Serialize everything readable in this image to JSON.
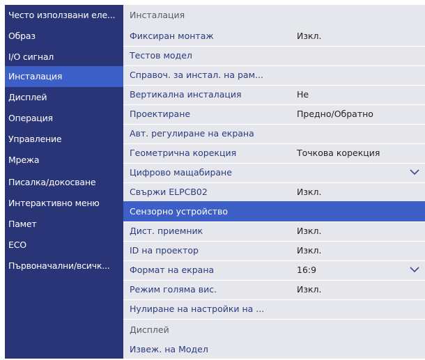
{
  "sidebar": {
    "items": [
      {
        "label": "Често използвани еле..."
      },
      {
        "label": "Образ"
      },
      {
        "label": "I/O сигнал"
      },
      {
        "label": "Инсталация"
      },
      {
        "label": "Дисплей"
      },
      {
        "label": "Операция"
      },
      {
        "label": "Управление"
      },
      {
        "label": "Мрежа"
      },
      {
        "label": "Писалка/докосване"
      },
      {
        "label": "Интерактивно меню"
      },
      {
        "label": "Памет"
      },
      {
        "label": "ECO"
      },
      {
        "label": "Първоначални/всичк..."
      }
    ],
    "selected": "Инсталация"
  },
  "main": {
    "section_install": "Инсталация",
    "rows": [
      {
        "label": "Фиксиран монтаж",
        "value": "Изкл."
      },
      {
        "label": "Тестов модел",
        "value": ""
      },
      {
        "label": "Справоч. за инстал. на рам...",
        "value": ""
      },
      {
        "label": "Вертикална инсталация",
        "value": "Не"
      },
      {
        "label": "Проектиране",
        "value": "Предно/Обратно"
      },
      {
        "label": "Авт. регулиране на екрана",
        "value": ""
      },
      {
        "label": "Геометрична корекция",
        "value": "Точкова корекция"
      },
      {
        "label": "Цифрово мащабиране",
        "value": ""
      },
      {
        "label": "Свържи ELPCB02",
        "value": "Изкл."
      },
      {
        "label": "Сензорно устройство",
        "value": ""
      },
      {
        "label": "Дист. приемник",
        "value": "Изкл."
      },
      {
        "label": "ID на проектор",
        "value": "Изкл."
      },
      {
        "label": "Формат на екрана",
        "value": "16:9"
      },
      {
        "label": "Режим голяма вис.",
        "value": "Изкл."
      },
      {
        "label": "Нулиране на настройки на ...",
        "value": ""
      }
    ],
    "selected_row": "Сензорно устройство",
    "section_display": "Дисплей",
    "display_rows": [
      {
        "label": "Извеж. на Модел",
        "value": ""
      }
    ]
  },
  "icons": {
    "dropdown": "chevron-down-icon"
  },
  "colors": {
    "sidebar_bg": "#2a3577",
    "selected": "#3d60c8",
    "panel_bg": "#e6e7ec",
    "label_text": "#2b3a7e"
  }
}
